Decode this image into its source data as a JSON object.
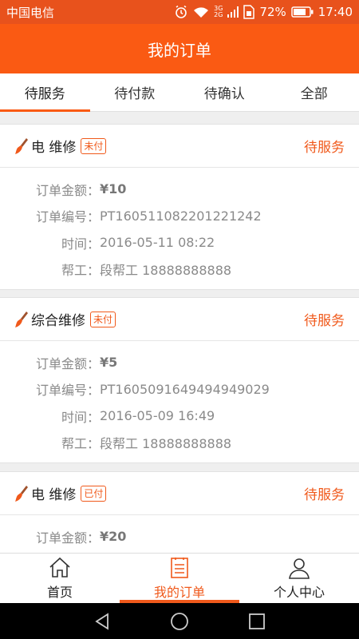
{
  "status_bar": {
    "carrier": "中国电信",
    "battery": "72%",
    "time": "17:40",
    "net_top": "3G",
    "net_bottom": "2G"
  },
  "header": {
    "title": "我的订单"
  },
  "tabs": [
    {
      "label": "待服务",
      "active": true
    },
    {
      "label": "待付款",
      "active": false
    },
    {
      "label": "待确认",
      "active": false
    },
    {
      "label": "全部",
      "active": false
    }
  ],
  "orders": [
    {
      "service": "电 维修",
      "pay_badge": "未付",
      "status": "待服务",
      "amount_label": "订单金额：",
      "amount": "¥10",
      "number_label": "订单编号：",
      "number": "PT160511082201221242",
      "time_label": "时间：",
      "time": "2016-05-11 08:22",
      "worker_label": "帮工：",
      "worker": "段帮工 18888888888"
    },
    {
      "service": "综合维修",
      "pay_badge": "未付",
      "status": "待服务",
      "amount_label": "订单金额：",
      "amount": "¥5",
      "number_label": "订单编号：",
      "number": "PT1605091649494949029",
      "time_label": "时间：",
      "time": "2016-05-09 16:49",
      "worker_label": "帮工：",
      "worker": "段帮工 18888888888"
    },
    {
      "service": "电 维修",
      "pay_badge": "已付",
      "status": "待服务",
      "amount_label": "订单金额：",
      "amount": "¥20"
    }
  ],
  "bottom_nav": [
    {
      "label": "首页",
      "icon": "home-icon",
      "active": false
    },
    {
      "label": "我的订单",
      "icon": "order-list-icon",
      "active": true
    },
    {
      "label": "个人中心",
      "icon": "user-icon",
      "active": false
    }
  ],
  "colors": {
    "accent": "#fa5a13",
    "status_bar": "#e8521c"
  }
}
